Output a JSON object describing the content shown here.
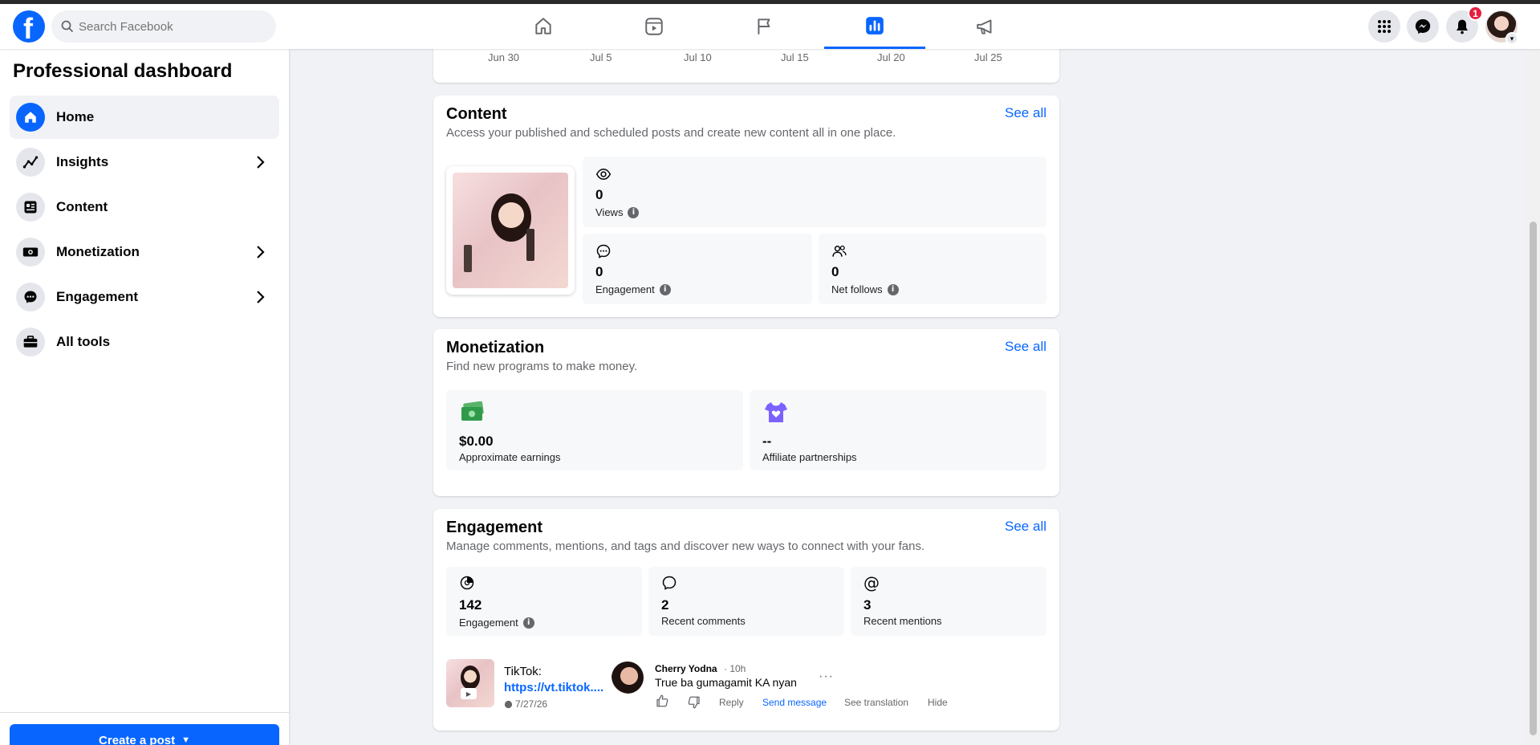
{
  "header": {
    "search_placeholder": "Search Facebook",
    "notification_count": "1",
    "nav_tabs": [
      "home-tab",
      "reels-tab",
      "pages-tab",
      "professional-dashboard-tab",
      "ads-tab"
    ]
  },
  "sidebar": {
    "title": "Professional dashboard",
    "items": [
      {
        "label": "Home",
        "icon": "home-icon",
        "active": true
      },
      {
        "label": "Insights",
        "icon": "insights-icon",
        "has_chevron": true
      },
      {
        "label": "Content",
        "icon": "content-icon"
      },
      {
        "label": "Monetization",
        "icon": "monetization-icon",
        "has_chevron": true
      },
      {
        "label": "Engagement",
        "icon": "engagement-icon",
        "has_chevron": true
      },
      {
        "label": "All tools",
        "icon": "toolbox-icon"
      }
    ],
    "create_post_label": "Create a post"
  },
  "chart_axis": {
    "ticks": [
      "Jun 30",
      "Jul 5",
      "Jul 10",
      "Jul 15",
      "Jul 20",
      "Jul 25"
    ]
  },
  "content": {
    "title": "Content",
    "subtitle": "Access your published and scheduled posts and create new content all in one place.",
    "see_all": "See all",
    "views": {
      "value": "0",
      "label": "Views"
    },
    "engagement": {
      "value": "0",
      "label": "Engagement"
    },
    "net_follows": {
      "value": "0",
      "label": "Net follows"
    }
  },
  "monetization": {
    "title": "Monetization",
    "subtitle": "Find new programs to make money.",
    "see_all": "See all",
    "earnings": {
      "value": "$0.00",
      "label": "Approximate earnings"
    },
    "affiliate": {
      "value": "--",
      "label": "Affiliate partnerships"
    }
  },
  "engagement": {
    "title": "Engagement",
    "subtitle": "Manage comments, mentions, and tags and discover new ways to connect with your fans.",
    "see_all": "See all",
    "total": {
      "value": "142",
      "label": "Engagement"
    },
    "comments": {
      "value": "2",
      "label": "Recent comments"
    },
    "mentions": {
      "value": "3",
      "label": "Recent mentions"
    },
    "post": {
      "title": "TikTok:",
      "link": "https://vt.tiktok....",
      "date": "7/27/26"
    },
    "comment": {
      "author": "Cherry Yodna",
      "time": "· 10h",
      "text": "True ba gumagamit KA nyan",
      "actions": {
        "reply": "Reply",
        "send_message": "Send message",
        "see_translation": "See translation",
        "hide": "Hide"
      }
    }
  },
  "colors": {
    "accent": "#0866ff",
    "badge": "#e41e3f"
  }
}
